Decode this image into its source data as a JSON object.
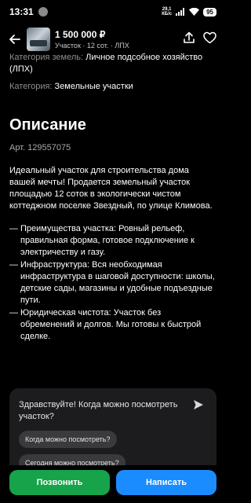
{
  "status_bar": {
    "time": "13:31",
    "net_speed_value": "29,1",
    "net_speed_unit": "КБ/с",
    "battery": "95"
  },
  "header": {
    "price": "1 500 000 ₽",
    "subtitle": "Участок · 12 сот. · ЛПХ"
  },
  "params": [
    {
      "label": "Категория земель:",
      "value": "Личное подсобное хозяйство (ЛПХ)"
    },
    {
      "label": "Категория:",
      "value": "Земельные участки"
    }
  ],
  "description": {
    "title": "Описание",
    "article": "Арт. 129557075",
    "text": "Идеальный участок для строительства дома вашей мечты! Продается земельный участок площадью 12 соток в экологически чистом коттеджном поселке Звездный, по улице Климова.",
    "bullets": [
      "Преимущества участка: Ровный рельеф, правильная форма, готовое подключение к электричеству и газу.",
      "Инфраструктура: Вся необходимая инфраструктура в шаговой доступности: школы, детские сады, магазины и удобные подъездные пути.",
      "Юридическая чистота: Участок без обременений и долгов. Мы готовы к быстрой сделке."
    ]
  },
  "chat": {
    "message": "Здравствуйте! Когда можно посмотреть участок?",
    "suggestions": [
      "Когда можно посмотреть?",
      "Сегодня можно посмотреть?"
    ]
  },
  "actions": {
    "call": "Позвонить",
    "write": "Написать"
  },
  "colors": {
    "call_button": "#16a34a",
    "write_button": "#1a8cff"
  },
  "icons": [
    "back-arrow-icon",
    "share-icon",
    "heart-icon",
    "send-icon",
    "wifi-icon",
    "signal-icon"
  ]
}
